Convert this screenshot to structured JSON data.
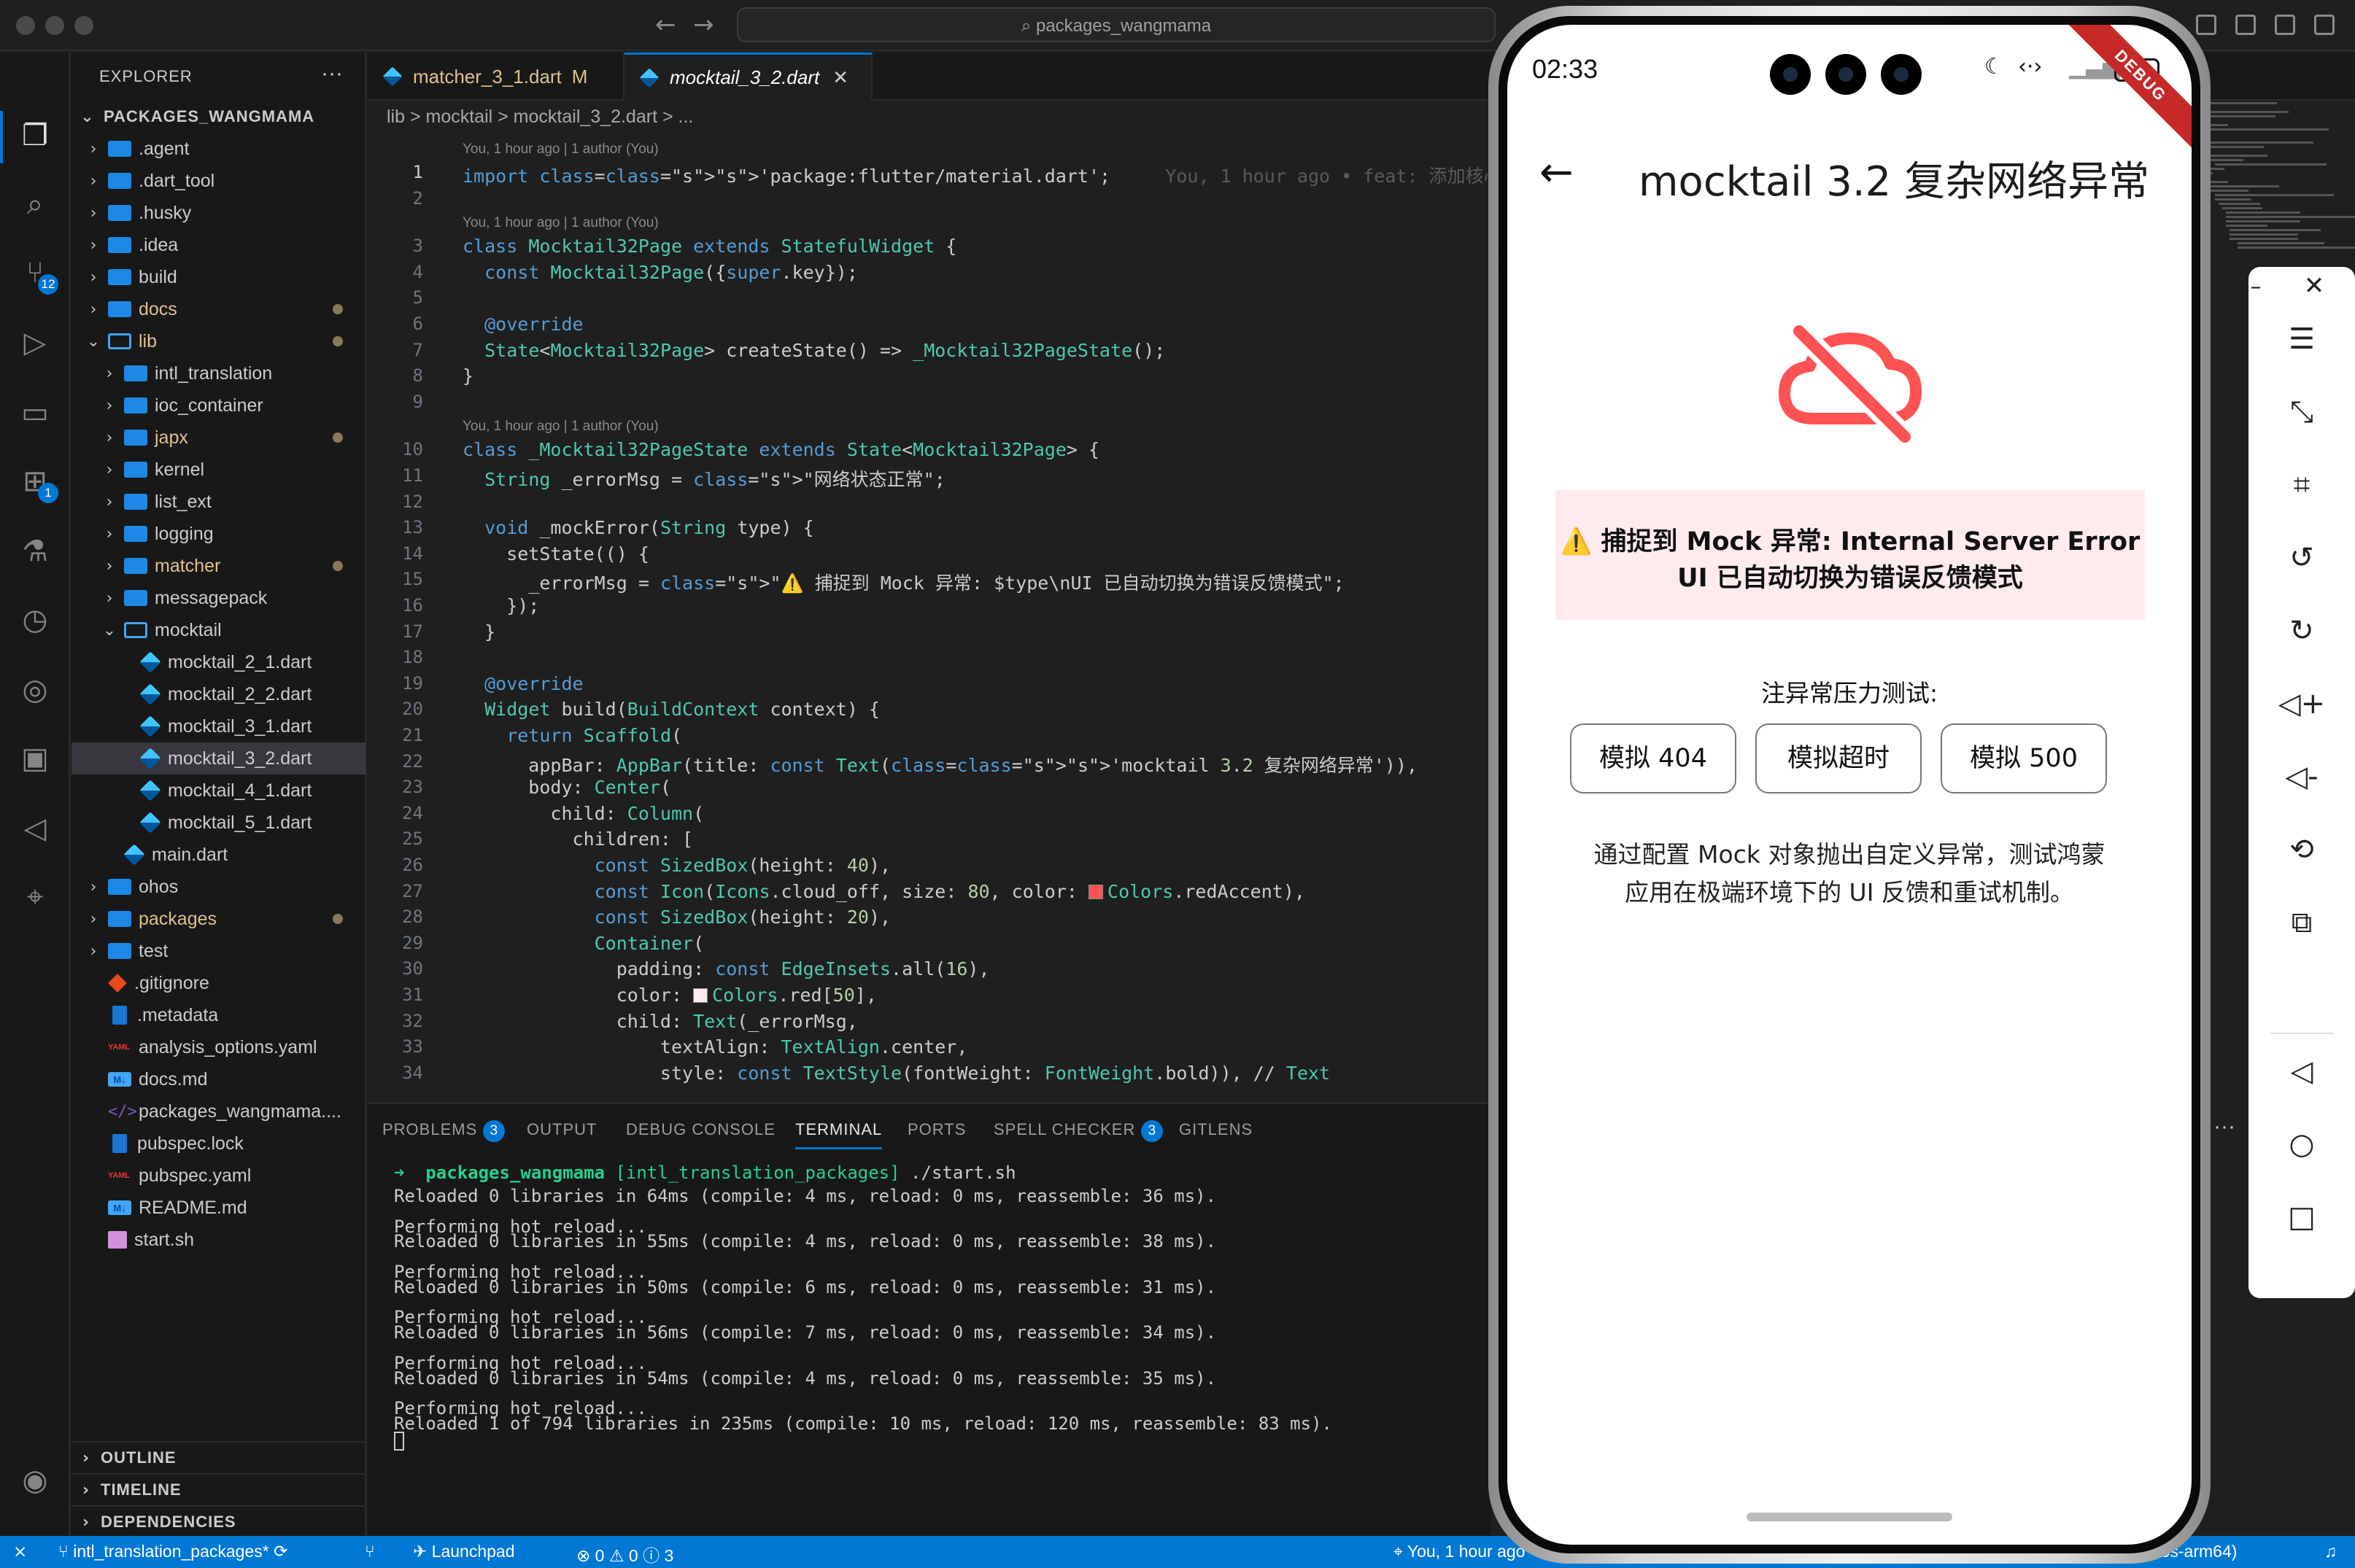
{
  "window": {
    "search_text": "packages_wangmama"
  },
  "activity_bar": {
    "scm_badge": "12",
    "extensions_badge": "1"
  },
  "explorer": {
    "title": "EXPLORER",
    "more": "···",
    "root": "PACKAGES_WANGMAMA",
    "items": [
      {
        "label": ".agent",
        "type": "folder",
        "depth": 1
      },
      {
        "label": ".dart_tool",
        "type": "folder",
        "depth": 1
      },
      {
        "label": ".husky",
        "type": "folder",
        "depth": 1
      },
      {
        "label": ".idea",
        "type": "folder",
        "depth": 1
      },
      {
        "label": "build",
        "type": "folder",
        "depth": 1
      },
      {
        "label": "docs",
        "type": "folder",
        "depth": 1,
        "modified": true
      },
      {
        "label": "lib",
        "type": "folder-open",
        "depth": 1,
        "modified": true
      },
      {
        "label": "intl_translation",
        "type": "folder",
        "depth": 2
      },
      {
        "label": "ioc_container",
        "type": "folder",
        "depth": 2
      },
      {
        "label": "japx",
        "type": "folder",
        "depth": 2,
        "modified": true
      },
      {
        "label": "kernel",
        "type": "folder",
        "depth": 2
      },
      {
        "label": "list_ext",
        "type": "folder",
        "depth": 2
      },
      {
        "label": "logging",
        "type": "folder",
        "depth": 2
      },
      {
        "label": "matcher",
        "type": "folder",
        "depth": 2,
        "modified": true
      },
      {
        "label": "messagepack",
        "type": "folder",
        "depth": 2
      },
      {
        "label": "mocktail",
        "type": "folder-open",
        "depth": 2
      },
      {
        "label": "mocktail_2_1.dart",
        "type": "dart",
        "depth": 3
      },
      {
        "label": "mocktail_2_2.dart",
        "type": "dart",
        "depth": 3
      },
      {
        "label": "mocktail_3_1.dart",
        "type": "dart",
        "depth": 3
      },
      {
        "label": "mocktail_3_2.dart",
        "type": "dart",
        "depth": 3,
        "selected": true
      },
      {
        "label": "mocktail_4_1.dart",
        "type": "dart",
        "depth": 3
      },
      {
        "label": "mocktail_5_1.dart",
        "type": "dart",
        "depth": 3
      },
      {
        "label": "main.dart",
        "type": "dart",
        "depth": 2
      },
      {
        "label": "ohos",
        "type": "folder",
        "depth": 1
      },
      {
        "label": "packages",
        "type": "folder",
        "depth": 1,
        "modified": true
      },
      {
        "label": "test",
        "type": "folder",
        "depth": 1
      },
      {
        "label": ".gitignore",
        "type": "git",
        "depth": 1
      },
      {
        "label": ".metadata",
        "type": "doc",
        "depth": 1
      },
      {
        "label": "analysis_options.yaml",
        "type": "yaml",
        "depth": 1
      },
      {
        "label": "docs.md",
        "type": "md",
        "depth": 1
      },
      {
        "label": "packages_wangmama....",
        "type": "code",
        "depth": 1
      },
      {
        "label": "pubspec.lock",
        "type": "doc",
        "depth": 1
      },
      {
        "label": "pubspec.yaml",
        "type": "yaml",
        "depth": 1
      },
      {
        "label": "README.md",
        "type": "md",
        "depth": 1
      },
      {
        "label": "start.sh",
        "type": "sh",
        "depth": 1
      }
    ],
    "sections": [
      "OUTLINE",
      "TIMELINE",
      "DEPENDENCIES"
    ]
  },
  "tabs": [
    {
      "label": "matcher_3_1.dart",
      "badge": "M"
    },
    {
      "label": "mocktail_3_2.dart",
      "close": "✕"
    }
  ],
  "breadcrumb": "lib > mocktail > mocktail_3_2.dart > ...",
  "editor": {
    "blame": [
      {
        "before_line": 1,
        "text": "You, 1 hour ago | 1 author (You)"
      },
      {
        "before_line": 3,
        "text": "You, 1 hour ago | 1 author (You)"
      },
      {
        "before_line": 10,
        "text": "You, 1 hour ago | 1 author (You)"
      }
    ],
    "inline_blame": "You, 1 hour ago • feat: 添加核心包示例展示页面 …",
    "lines": [
      "import 'package:flutter/material.dart';",
      "",
      "class Mocktail32Page extends StatefulWidget {",
      "  const Mocktail32Page({super.key});",
      "",
      "  @override",
      "  State<Mocktail32Page> createState() => _Mocktail32PageState();",
      "}",
      "",
      "class _Mocktail32PageState extends State<Mocktail32Page> {",
      "  String _errorMsg = \"网络状态正常\";",
      "",
      "  void _mockError(String type) {",
      "    setState(() {",
      "      _errorMsg = \"⚠️ 捕捉到 Mock 异常: $type\\nUI 已自动切换为错误反馈模式\";",
      "    });",
      "  }",
      "",
      "  @override",
      "  Widget build(BuildContext context) {",
      "    return Scaffold(",
      "      appBar: AppBar(title: const Text('mocktail 3.2 复杂网络异常')),",
      "      body: Center(",
      "        child: Column(",
      "          children: [",
      "            const SizedBox(height: 40),",
      "            const Icon(Icons.cloud_off, size: 80, color: Colors.redAccent),",
      "            const SizedBox(height: 20),",
      "            Container(",
      "              padding: const EdgeInsets.all(16),",
      "              color: Colors.red[50],",
      "              child: Text(_errorMsg,",
      "                  textAlign: TextAlign.center,",
      "                  style: const TextStyle(fontWeight: FontWeight.bold)), // Text"
    ]
  },
  "panel": {
    "tabs": [
      {
        "label": "PROBLEMS",
        "badge": "3"
      },
      {
        "label": "OUTPUT"
      },
      {
        "label": "DEBUG CONSOLE"
      },
      {
        "label": "TERMINAL",
        "active": true
      },
      {
        "label": "PORTS"
      },
      {
        "label": "SPELL CHECKER",
        "badge": "3"
      },
      {
        "label": "GITLENS"
      }
    ],
    "more": "···",
    "prompt_path": "packages_wangmama",
    "prompt_branch": "[intl_translation_packages]",
    "prompt_cmd": "./start.sh",
    "lines": [
      "Reloaded 0 libraries in 64ms (compile: 4 ms, reload: 0 ms, reassemble: 36 ms).",
      "",
      "Performing hot reload...",
      "Reloaded 0 libraries in 55ms (compile: 4 ms, reload: 0 ms, reassemble: 38 ms).",
      "",
      "Performing hot reload...",
      "Reloaded 0 libraries in 50ms (compile: 6 ms, reload: 0 ms, reassemble: 31 ms).",
      "",
      "Performing hot reload...",
      "Reloaded 0 libraries in 56ms (compile: 7 ms, reload: 0 ms, reassemble: 34 ms).",
      "",
      "Performing hot reload...",
      "Reloaded 0 libraries in 54ms (compile: 4 ms, reload: 0 ms, reassemble: 35 ms).",
      "",
      "Performing hot reload...",
      "Reloaded 1 of 794 libraries in 235ms (compile: 10 ms, reload: 120 ms, reassemble: 83 ms)."
    ]
  },
  "statusbar": {
    "branch": "intl_translation_packages*",
    "launchpad": "Launchpad",
    "errors": "0",
    "warnings": "0",
    "info": "3",
    "blame": "You, 1 hour ago",
    "device": "...7 (ohos-arm64)"
  },
  "phone": {
    "time": "02:33",
    "battery": "100",
    "debug_banner": "DEBUG",
    "appbar_title": "mocktail 3.2 复杂网络异常",
    "error_line1": "⚠️ 捕捉到 Mock 异常: Internal Server Error",
    "error_line2": "UI 已自动切换为错误反馈模式",
    "section_label": "注异常压力测试:",
    "buttons": [
      "模拟 404",
      "模拟超时",
      "模拟 500"
    ],
    "description_line1": "通过配置 Mock 对象抛出自定义异常，测试鸿蒙",
    "description_line2": "应用在极端环境下的 UI 反馈和重试机制。",
    "icon_color": "#ff5252",
    "error_bg": "#ffebee"
  }
}
